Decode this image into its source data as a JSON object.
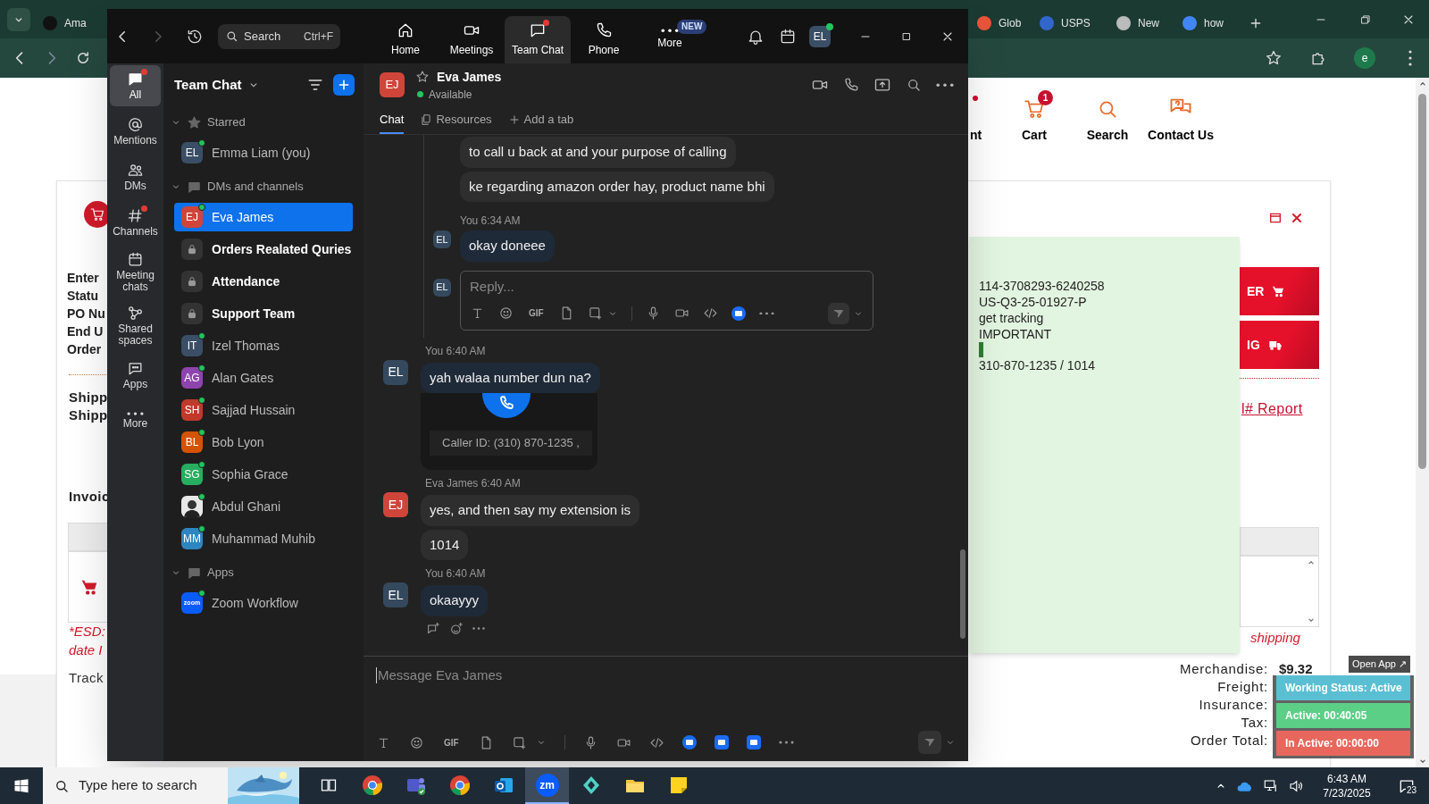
{
  "browser": {
    "tabs": [
      {
        "label": "Ama",
        "color": "#111111"
      },
      {
        "label": "Glob",
        "color": "#e8543a"
      },
      {
        "label": "USPS",
        "color": "#3366cc"
      },
      {
        "label": "New",
        "color": "#bbbbbb"
      },
      {
        "label": "how",
        "color": "#4285f4"
      }
    ],
    "profile_initial": "e",
    "page": {
      "nav": [
        {
          "label": "nt"
        },
        {
          "label": "Cart",
          "badge": "1"
        },
        {
          "label": "Search"
        },
        {
          "label": "Contact Us"
        }
      ],
      "order_labels": [
        "Enter",
        "Statu",
        "PO Nu",
        "End U",
        "Order"
      ],
      "shipping_labels": [
        "Shipp",
        "Shipp"
      ],
      "invoice_label": "Invoic",
      "buttons": [
        {
          "label": "ER",
          "kind": "cart"
        },
        {
          "label": "IG",
          "kind": "truck"
        }
      ],
      "report_link": "l# Report",
      "esd_note": [
        "*ESD:",
        "date I"
      ],
      "shipping_note": "shipping",
      "tracking_label": "Track",
      "totals": [
        {
          "label": "Merchandise:",
          "value": "$9.32"
        },
        {
          "label": "Freight:"
        },
        {
          "label": "Insurance:"
        },
        {
          "label": "Tax:"
        },
        {
          "label": "Order Total:"
        }
      ]
    }
  },
  "sticky_note": {
    "lines": [
      {
        "kind": "text",
        "text": "114-3708293-6240258"
      },
      {
        "kind": "text",
        "text": "US-Q3-25-01927-P"
      },
      {
        "kind": "text",
        "text": "get tracking"
      },
      {
        "kind": "text",
        "text": "IMPORTANT"
      },
      {
        "kind": "marker"
      },
      {
        "kind": "text",
        "text": "310-870-1235 / 1014"
      }
    ]
  },
  "tracker": {
    "open_app": "Open App ↗",
    "rows": [
      {
        "text": "Working Status: Active",
        "color": "#5bbfd3"
      },
      {
        "text": "Active: 00:40:05",
        "color": "#5ccf87"
      },
      {
        "text": "In Active: 00:00:00",
        "color": "#e7675d"
      }
    ]
  },
  "zoom": {
    "search": {
      "placeholder": "Search",
      "shortcut": "Ctrl+F"
    },
    "nav_tabs": [
      {
        "label": "Home",
        "kind": "home",
        "selected": false,
        "alert": false
      },
      {
        "label": "Meetings",
        "kind": "meetings",
        "selected": false,
        "alert": false
      },
      {
        "label": "Team Chat",
        "kind": "chat",
        "selected": true,
        "alert": true
      },
      {
        "label": "Phone",
        "kind": "phone",
        "selected": false,
        "alert": false
      },
      {
        "label": "More",
        "kind": "more",
        "selected": false,
        "alert": false,
        "badge": "NEW"
      }
    ],
    "profile": {
      "initials": "EL",
      "online": true
    },
    "rail": [
      {
        "label": "All",
        "kind": "all",
        "selected": true,
        "alert": true
      },
      {
        "label": "Mentions",
        "kind": "mentions",
        "selected": false,
        "alert": false
      },
      {
        "label": "DMs",
        "kind": "dms",
        "selected": false,
        "alert": false
      },
      {
        "label": "Channels",
        "kind": "channels",
        "selected": false,
        "alert": true
      },
      {
        "label": "Meeting chats",
        "kind": "meetings",
        "selected": false,
        "alert": false
      },
      {
        "label": "Shared spaces",
        "kind": "shared",
        "selected": false,
        "alert": false
      },
      {
        "label": "Apps",
        "kind": "apps",
        "selected": false,
        "alert": false
      },
      {
        "label": "More",
        "kind": "more",
        "selected": false,
        "alert": false
      }
    ],
    "sidebar": {
      "title": "Team Chat",
      "sections": [
        {
          "label": "Starred",
          "kind": "starred",
          "expanded": true,
          "items": [
            {
              "kind": "person",
              "initials": "EL",
              "name": "Emma Liam (you)",
              "color": "#3a4e66",
              "online": true,
              "unread": false,
              "selected": false
            }
          ]
        },
        {
          "label": "DMs and channels",
          "kind": "chats",
          "expanded": true,
          "items": [
            {
              "kind": "person",
              "initials": "EJ",
              "name": "Eva James",
              "color": "#d0453a",
              "online": true,
              "unread": false,
              "selected": true
            },
            {
              "kind": "channel",
              "name": "Orders Realated Quries",
              "unread": true,
              "selected": false
            },
            {
              "kind": "channel",
              "name": "Attendance",
              "unread": true,
              "selected": false
            },
            {
              "kind": "channel",
              "name": "Support Team",
              "unread": true,
              "selected": false
            },
            {
              "kind": "person",
              "initials": "IT",
              "name": "Izel Thomas",
              "color": "#3a4e66",
              "online": true,
              "unread": false,
              "selected": false
            },
            {
              "kind": "person",
              "initials": "AG",
              "name": "Alan Gates",
              "color": "#8e44ad",
              "online": true,
              "unread": false,
              "selected": false
            },
            {
              "kind": "person",
              "initials": "SH",
              "name": "Sajjad Hussain",
              "color": "#c0392b",
              "online": true,
              "unread": false,
              "selected": false
            },
            {
              "kind": "person",
              "initials": "BL",
              "name": "Bob Lyon",
              "color": "#d35400",
              "online": true,
              "unread": false,
              "selected": false
            },
            {
              "kind": "person",
              "initials": "SG",
              "name": "Sophia Grace",
              "color": "#27ae60",
              "online": true,
              "unread": false,
              "selected": false
            },
            {
              "name": "Abdul Ghani",
              "online": true,
              "unread": false,
              "selected": false
            },
            {
              "kind": "person",
              "initials": "MM",
              "name": "Muhammad Muhib",
              "color": "#2e86c1",
              "online": true,
              "unread": false,
              "selected": false
            }
          ]
        },
        {
          "label": "Apps",
          "kind": "apps",
          "expanded": true,
          "items": [
            {
              "kind": "app",
              "logo_text": "zoom",
              "name": "Zoom Workflow",
              "online": true,
              "unread": false,
              "selected": false
            }
          ]
        }
      ]
    },
    "chat": {
      "initials": "EJ",
      "color": "#d0453a",
      "name": "Eva James",
      "status": "Available",
      "tabs": [
        {
          "label": "Chat",
          "kind": "chat",
          "selected": true
        },
        {
          "label": "Resources",
          "kind": "resources",
          "selected": false
        },
        {
          "label": "Add a tab",
          "kind": "add",
          "selected": false
        }
      ],
      "thread": {
        "groups": [
          {
            "bubbles": [
              "to call u back at and your purpose of calling",
              "ke regarding amazon order hay, product name bhi"
            ]
          },
          {
            "sender": "You",
            "time": "6:34 AM",
            "initials": "EL",
            "mine": true,
            "bubbles": [
              "okay doneee"
            ]
          }
        ],
        "reply": {
          "initials": "EL",
          "placeholder": "Reply...",
          "tools": [
            {
              "kind": "format"
            },
            {
              "kind": "emoji"
            },
            {
              "kind": "gif",
              "label": "GIF"
            },
            {
              "kind": "file"
            },
            {
              "kind": "screenshot"
            },
            {
              "kind": "mic"
            },
            {
              "kind": "video"
            },
            {
              "kind": "code"
            },
            {
              "kind": "app"
            },
            {
              "kind": "more"
            }
          ]
        }
      },
      "messages": [
        {
          "sender": "You",
          "time": "6:40 AM",
          "initials": "EL",
          "mine": true,
          "bubbles": [
            "yah walaa number dun na?"
          ],
          "call_card": {
            "caller_id": "Caller ID: (310) 870-1235 ,"
          }
        },
        {
          "sender": "Eva James",
          "time": "6:40 AM",
          "initials": "EJ",
          "mine": false,
          "bubbles": [
            "yes, and then say my extension is",
            "1014"
          ]
        },
        {
          "sender": "You",
          "time": "6:40 AM",
          "initials": "EL",
          "mine": true,
          "bubbles": [
            "okaayyy"
          ],
          "actions": true
        }
      ]
    },
    "composer": {
      "placeholder": "Message Eva James",
      "tools": [
        {
          "kind": "format"
        },
        {
          "kind": "emoji"
        },
        {
          "kind": "gif",
          "label": "GIF"
        },
        {
          "kind": "file"
        },
        {
          "kind": "screenshot"
        },
        {
          "kind": "mic"
        },
        {
          "kind": "video"
        },
        {
          "kind": "code"
        },
        {
          "kind": "app"
        },
        {
          "kind": "app2"
        },
        {
          "kind": "app3"
        },
        {
          "kind": "more"
        }
      ]
    }
  },
  "taskbar": {
    "search_placeholder": "Type here to search",
    "apps": [
      {
        "kind": "taskview",
        "selected": false
      },
      {
        "kind": "chrome",
        "selected": false
      },
      {
        "kind": "teams",
        "selected": false
      },
      {
        "kind": "chrome",
        "selected": false
      },
      {
        "kind": "outlook",
        "selected": false
      },
      {
        "kind": "zoom",
        "label": "zm",
        "selected": true
      },
      {
        "kind": "kite",
        "selected": false
      },
      {
        "kind": "files",
        "selected": false
      },
      {
        "kind": "sticky",
        "selected": false
      }
    ],
    "time": "6:43 AM",
    "date": "7/23/2025",
    "notifications": "23"
  }
}
